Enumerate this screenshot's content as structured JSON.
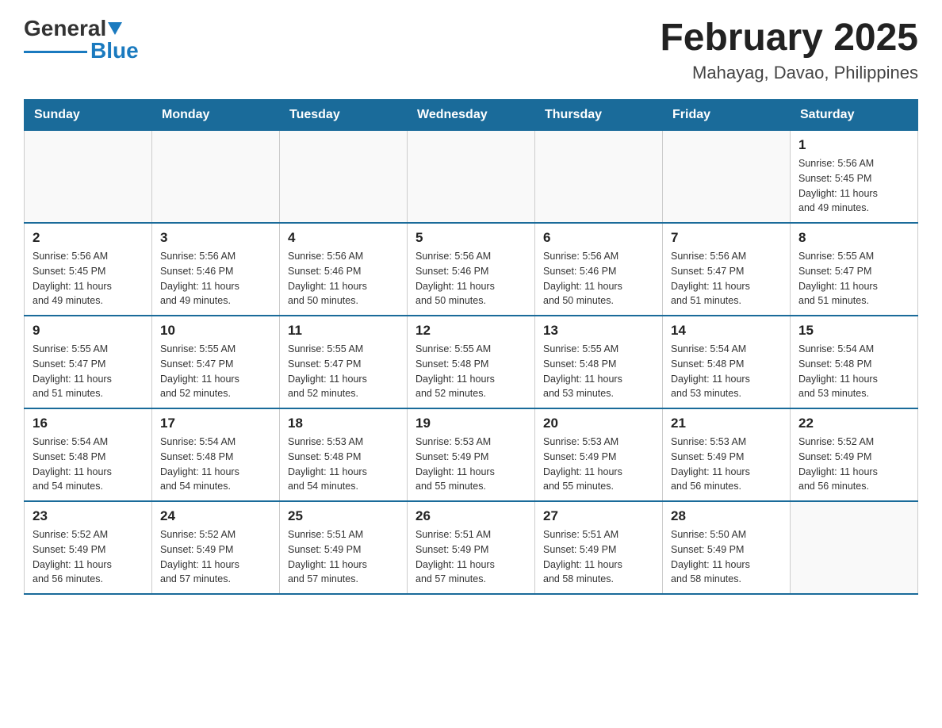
{
  "logo": {
    "general": "General",
    "blue": "Blue"
  },
  "header": {
    "title": "February 2025",
    "subtitle": "Mahayag, Davao, Philippines"
  },
  "days_of_week": [
    "Sunday",
    "Monday",
    "Tuesday",
    "Wednesday",
    "Thursday",
    "Friday",
    "Saturday"
  ],
  "weeks": [
    [
      {
        "day": "",
        "info": ""
      },
      {
        "day": "",
        "info": ""
      },
      {
        "day": "",
        "info": ""
      },
      {
        "day": "",
        "info": ""
      },
      {
        "day": "",
        "info": ""
      },
      {
        "day": "",
        "info": ""
      },
      {
        "day": "1",
        "info": "Sunrise: 5:56 AM\nSunset: 5:45 PM\nDaylight: 11 hours\nand 49 minutes."
      }
    ],
    [
      {
        "day": "2",
        "info": "Sunrise: 5:56 AM\nSunset: 5:45 PM\nDaylight: 11 hours\nand 49 minutes."
      },
      {
        "day": "3",
        "info": "Sunrise: 5:56 AM\nSunset: 5:46 PM\nDaylight: 11 hours\nand 49 minutes."
      },
      {
        "day": "4",
        "info": "Sunrise: 5:56 AM\nSunset: 5:46 PM\nDaylight: 11 hours\nand 50 minutes."
      },
      {
        "day": "5",
        "info": "Sunrise: 5:56 AM\nSunset: 5:46 PM\nDaylight: 11 hours\nand 50 minutes."
      },
      {
        "day": "6",
        "info": "Sunrise: 5:56 AM\nSunset: 5:46 PM\nDaylight: 11 hours\nand 50 minutes."
      },
      {
        "day": "7",
        "info": "Sunrise: 5:56 AM\nSunset: 5:47 PM\nDaylight: 11 hours\nand 51 minutes."
      },
      {
        "day": "8",
        "info": "Sunrise: 5:55 AM\nSunset: 5:47 PM\nDaylight: 11 hours\nand 51 minutes."
      }
    ],
    [
      {
        "day": "9",
        "info": "Sunrise: 5:55 AM\nSunset: 5:47 PM\nDaylight: 11 hours\nand 51 minutes."
      },
      {
        "day": "10",
        "info": "Sunrise: 5:55 AM\nSunset: 5:47 PM\nDaylight: 11 hours\nand 52 minutes."
      },
      {
        "day": "11",
        "info": "Sunrise: 5:55 AM\nSunset: 5:47 PM\nDaylight: 11 hours\nand 52 minutes."
      },
      {
        "day": "12",
        "info": "Sunrise: 5:55 AM\nSunset: 5:48 PM\nDaylight: 11 hours\nand 52 minutes."
      },
      {
        "day": "13",
        "info": "Sunrise: 5:55 AM\nSunset: 5:48 PM\nDaylight: 11 hours\nand 53 minutes."
      },
      {
        "day": "14",
        "info": "Sunrise: 5:54 AM\nSunset: 5:48 PM\nDaylight: 11 hours\nand 53 minutes."
      },
      {
        "day": "15",
        "info": "Sunrise: 5:54 AM\nSunset: 5:48 PM\nDaylight: 11 hours\nand 53 minutes."
      }
    ],
    [
      {
        "day": "16",
        "info": "Sunrise: 5:54 AM\nSunset: 5:48 PM\nDaylight: 11 hours\nand 54 minutes."
      },
      {
        "day": "17",
        "info": "Sunrise: 5:54 AM\nSunset: 5:48 PM\nDaylight: 11 hours\nand 54 minutes."
      },
      {
        "day": "18",
        "info": "Sunrise: 5:53 AM\nSunset: 5:48 PM\nDaylight: 11 hours\nand 54 minutes."
      },
      {
        "day": "19",
        "info": "Sunrise: 5:53 AM\nSunset: 5:49 PM\nDaylight: 11 hours\nand 55 minutes."
      },
      {
        "day": "20",
        "info": "Sunrise: 5:53 AM\nSunset: 5:49 PM\nDaylight: 11 hours\nand 55 minutes."
      },
      {
        "day": "21",
        "info": "Sunrise: 5:53 AM\nSunset: 5:49 PM\nDaylight: 11 hours\nand 56 minutes."
      },
      {
        "day": "22",
        "info": "Sunrise: 5:52 AM\nSunset: 5:49 PM\nDaylight: 11 hours\nand 56 minutes."
      }
    ],
    [
      {
        "day": "23",
        "info": "Sunrise: 5:52 AM\nSunset: 5:49 PM\nDaylight: 11 hours\nand 56 minutes."
      },
      {
        "day": "24",
        "info": "Sunrise: 5:52 AM\nSunset: 5:49 PM\nDaylight: 11 hours\nand 57 minutes."
      },
      {
        "day": "25",
        "info": "Sunrise: 5:51 AM\nSunset: 5:49 PM\nDaylight: 11 hours\nand 57 minutes."
      },
      {
        "day": "26",
        "info": "Sunrise: 5:51 AM\nSunset: 5:49 PM\nDaylight: 11 hours\nand 57 minutes."
      },
      {
        "day": "27",
        "info": "Sunrise: 5:51 AM\nSunset: 5:49 PM\nDaylight: 11 hours\nand 58 minutes."
      },
      {
        "day": "28",
        "info": "Sunrise: 5:50 AM\nSunset: 5:49 PM\nDaylight: 11 hours\nand 58 minutes."
      },
      {
        "day": "",
        "info": ""
      }
    ]
  ]
}
